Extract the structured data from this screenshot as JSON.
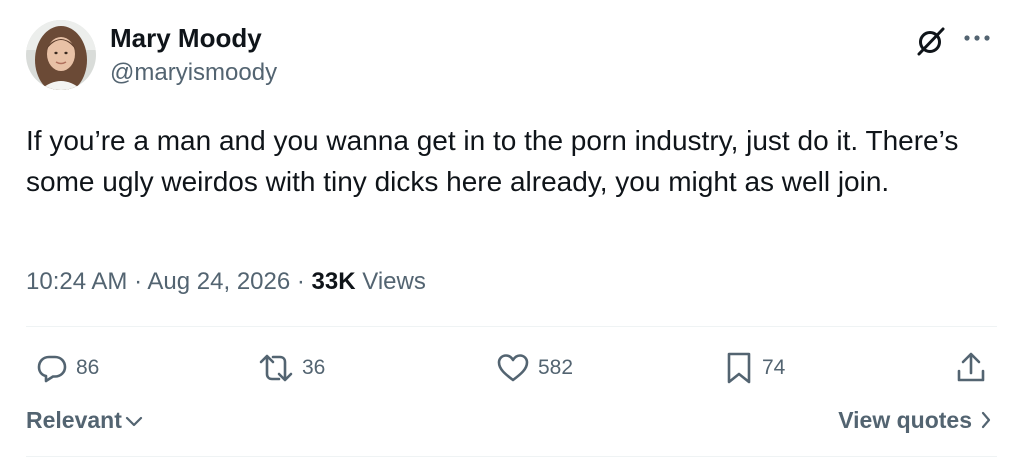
{
  "author": {
    "name": "Mary Moody",
    "handle": "@maryismoody",
    "avatar_icon": "profile-photo"
  },
  "header_icons": {
    "grok": "grok-slash-icon",
    "more": "more-horizontal-icon"
  },
  "post": {
    "text": "If you’re a man and you wanna get in to the porn industry, just do it. There’s some ugly weirdos with tiny dicks here already, you might as well join."
  },
  "meta": {
    "time": "10:24 AM",
    "separator1": " · ",
    "date": "Aug 24, 2026",
    "separator2": " · ",
    "views_count": "33K",
    "views_label": " Views"
  },
  "actions": {
    "replies": "86",
    "reposts": "36",
    "likes": "582",
    "bookmarks": "74"
  },
  "replies_sort": {
    "selected": "Relevant"
  },
  "quotes_link": {
    "label": "View quotes"
  },
  "colors": {
    "text_primary": "#0f1419",
    "text_secondary": "#536471",
    "divider": "#eff3f4"
  }
}
